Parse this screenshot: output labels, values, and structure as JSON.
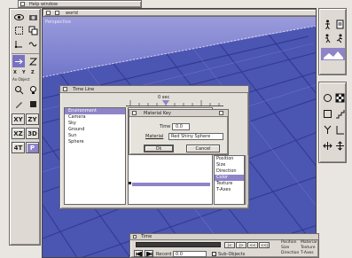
{
  "help_window": {
    "title": "Help window"
  },
  "world_window": {
    "title": "world",
    "view_label": "Perspective"
  },
  "left_toolbar": {
    "icons": [
      "eye-icon",
      "camera-icon",
      "rect-select-icon",
      "copy-icon",
      "node-icon",
      "wave-icon",
      "arrow-right-icon",
      "z-icon",
      "magnify-icon",
      "light-icon",
      "edit-icon",
      "object-icon"
    ],
    "coord_x": "X",
    "coord_y": "Y",
    "coord_z": "Z",
    "axes_label": "Ax Object",
    "view_buttons": [
      "XY",
      "ZY",
      "XZ",
      "3D",
      "4T",
      "P"
    ]
  },
  "right_toolbar": {
    "icons_top": [
      "figure-icon",
      "scroll-icon",
      "walking-figure-icon",
      "runner-icon",
      "landscape-icon"
    ],
    "icons_mid": [
      "circle-icon",
      "checker-icon",
      "square-icon",
      "steps-icon",
      "fork-icon",
      "bar-icon",
      "move-icon",
      "plus-icon"
    ]
  },
  "timeline": {
    "title": "Time Line",
    "ruler_label": "0 sec",
    "objects": [
      "Environment",
      "Camera",
      "Sky",
      "Ground",
      "Sun",
      "Sphere"
    ],
    "properties": [
      "Position",
      "Size",
      "Direction",
      "Color",
      "Texture",
      "T-Axes"
    ],
    "selected_object_index": 0,
    "selected_property_index": 3
  },
  "material_key": {
    "title": "Material Key",
    "time_label": "Time",
    "time_value": "0.0",
    "material_label": "Material",
    "material_value": "Red Shiny Sphere",
    "ok_label": "Ok",
    "cancel_label": "Cancel"
  },
  "time_panel": {
    "title": "Time",
    "record_label": "Record",
    "record_value": "0.0",
    "subobjects_label": "Sub-Objects",
    "nav_glyphs": [
      "|<",
      "|>",
      "<<",
      "<<|"
    ],
    "checks_col1": [
      "Position",
      "Size",
      "Direction"
    ],
    "checks_col2": [
      "Material",
      "Texture",
      "T-Axes"
    ]
  },
  "colors": {
    "accent": "#8f84c7",
    "viewport_floor": "#4e57b4",
    "viewport_sky": "#9698d8"
  }
}
